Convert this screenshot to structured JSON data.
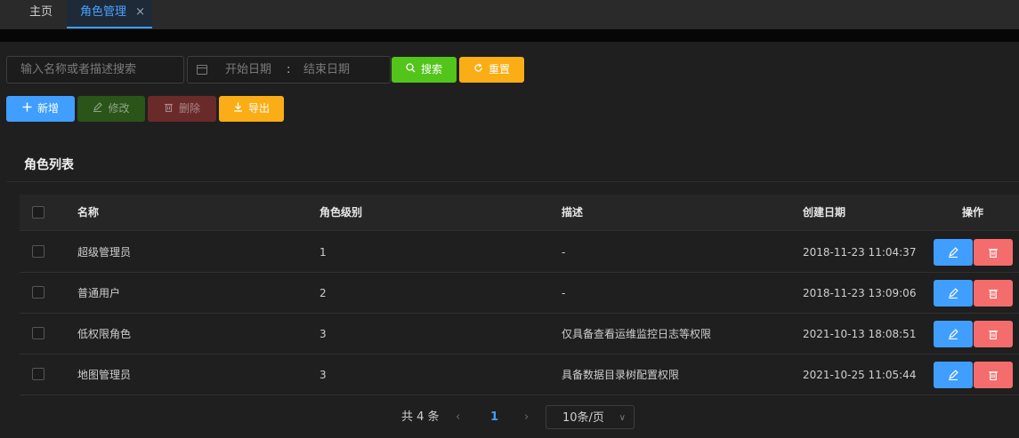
{
  "tabs": [
    {
      "label": "主页"
    },
    {
      "label": "角色管理",
      "close": "×"
    }
  ],
  "filters": {
    "search_placeholder": "输入名称或者描述搜索",
    "start_date_placeholder": "开始日期",
    "range_separator": ":",
    "end_date_placeholder": "结束日期",
    "search_label": "搜索",
    "reset_label": "重置"
  },
  "toolbar": {
    "add_label": "新增",
    "edit_label": "修改",
    "delete_label": "删除",
    "export_label": "导出"
  },
  "section_title": "角色列表",
  "table": {
    "headers": {
      "name": "名称",
      "level": "角色级别",
      "desc": "描述",
      "date": "创建日期",
      "ops": "操作"
    },
    "rows": [
      {
        "name": "超级管理员",
        "level": "1",
        "desc": "-",
        "date": "2018-11-23 11:04:37"
      },
      {
        "name": "普通用户",
        "level": "2",
        "desc": "-",
        "date": "2018-11-23 13:09:06"
      },
      {
        "name": "低权限角色",
        "level": "3",
        "desc": "仅具备查看运维监控日志等权限",
        "date": "2021-10-13 18:08:51"
      },
      {
        "name": "地图管理员",
        "level": "3",
        "desc": "具备数据目录树配置权限",
        "date": "2021-10-25 11:05:44"
      }
    ]
  },
  "pagination": {
    "total": "共 4 条",
    "prev": "‹",
    "current_page": "1",
    "next": "›",
    "page_size": "10条/页",
    "chevron": "∨"
  },
  "colors": {
    "primary": "#409eff",
    "success": "#52c41a",
    "warning": "#faad14",
    "danger": "#f56c6c",
    "background": "#1f1f1f"
  }
}
